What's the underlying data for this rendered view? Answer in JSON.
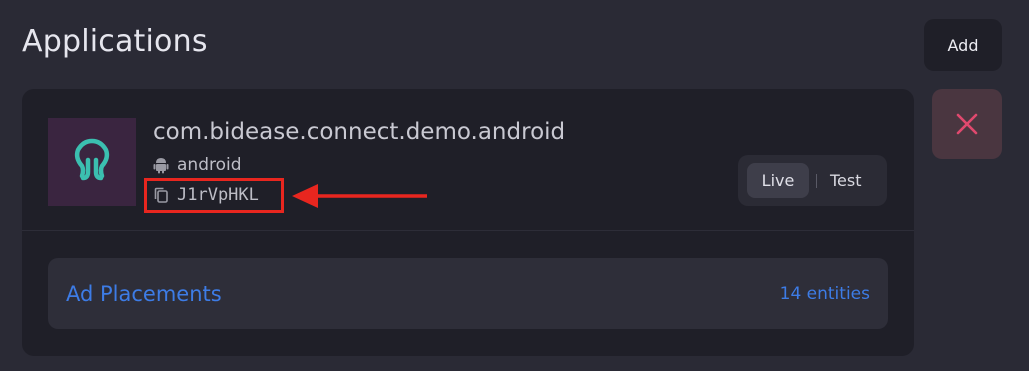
{
  "header": {
    "title": "Applications",
    "add_label": "Add"
  },
  "app": {
    "name": "com.bidease.connect.demo.android",
    "platform": "android",
    "platform_icon": "android-icon",
    "app_id": "J1rVpHKL",
    "copy_icon": "copy-icon",
    "logo_icon": "omega-logo-icon",
    "env_toggle": {
      "options": [
        "Live",
        "Test"
      ],
      "selected": "Live"
    },
    "placements": {
      "label": "Ad Placements",
      "count": "14 entities"
    }
  },
  "delete_icon": "close-icon",
  "colors": {
    "background": "#2a2a35",
    "card": "#1f1f28",
    "accent_link": "#3d7ce6",
    "delete_accent": "#e0496e",
    "logo_bg": "#3a2540",
    "logo_fg": "#3bbfb0",
    "annotation": "#e8261f"
  }
}
